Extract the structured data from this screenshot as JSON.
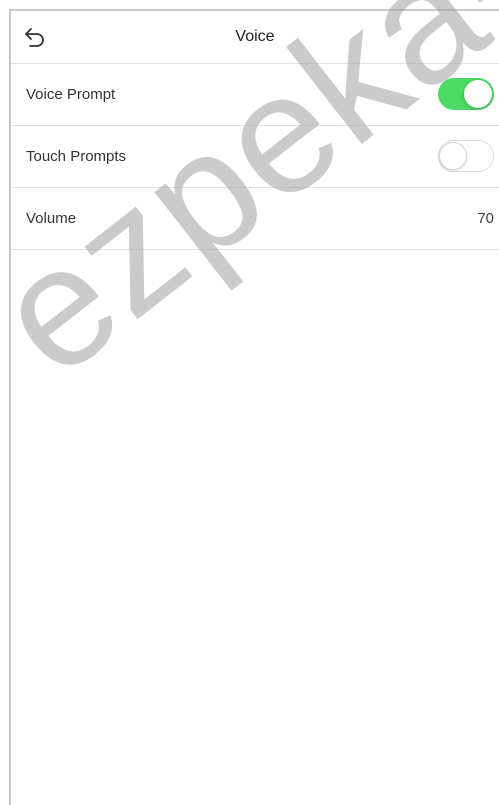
{
  "header": {
    "title": "Voice",
    "back_icon": "back-arrow-icon"
  },
  "settings": [
    {
      "label": "Voice Prompt",
      "type": "toggle",
      "state": "on"
    },
    {
      "label": "Touch Prompts",
      "type": "toggle",
      "state": "off"
    },
    {
      "label": "Volume",
      "type": "value",
      "value": "70"
    }
  ],
  "colors": {
    "toggle_on": "#4cd964",
    "toggle_off_border": "#dcdcdc",
    "divider": "#e2e2e2",
    "text": "#333333"
  },
  "watermark": {
    "text": "ezpeka-s"
  }
}
